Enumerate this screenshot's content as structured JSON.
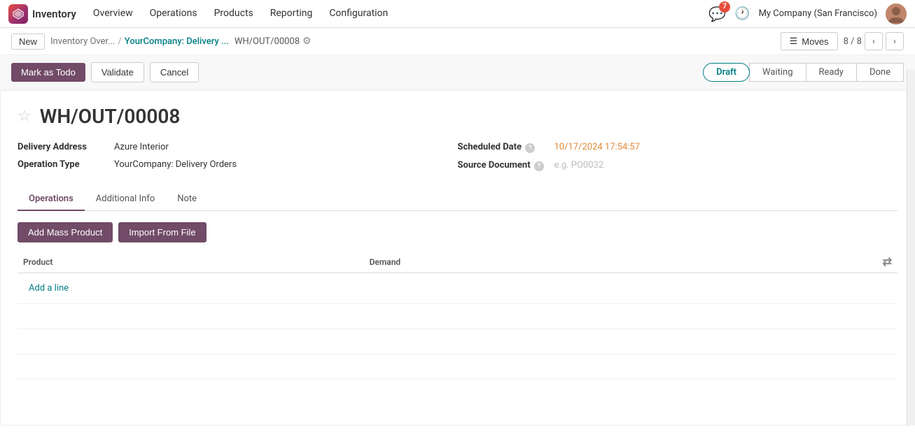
{
  "topnav": {
    "app_name": "Inventory",
    "menu_items": [
      "Overview",
      "Operations",
      "Products",
      "Reporting",
      "Configuration"
    ],
    "notification_count": "7",
    "company": "My Company (San Francisco)"
  },
  "breadcrumb": {
    "new_label": "New",
    "parent1": "Inventory Over...",
    "separator": "/",
    "parent2": "YourCompany: Delivery ...",
    "record_id": "WH/OUT/00008",
    "moves_label": "Moves",
    "record_position": "8 / 8"
  },
  "action_bar": {
    "mark_todo_label": "Mark as Todo",
    "validate_label": "Validate",
    "cancel_label": "Cancel",
    "status_steps": [
      "Draft",
      "Waiting",
      "Ready",
      "Done"
    ],
    "active_status": "Draft"
  },
  "form": {
    "title": "WH/OUT/00008",
    "delivery_address_label": "Delivery Address",
    "delivery_address_value": "Azure Interior",
    "operation_type_label": "Operation Type",
    "operation_type_value": "YourCompany: Delivery Orders",
    "scheduled_date_label": "Scheduled Date",
    "scheduled_date_value": "10/17/2024 17:54:57",
    "source_document_label": "Source Document",
    "source_document_placeholder": "e.g. PO0032"
  },
  "tabs": {
    "items": [
      "Operations",
      "Additional Info",
      "Note"
    ],
    "active": "Operations"
  },
  "table": {
    "add_mass_label": "Add Mass Product",
    "import_label": "Import From File",
    "col_product": "Product",
    "col_demand": "Demand",
    "add_line_label": "Add a line",
    "rows": []
  }
}
